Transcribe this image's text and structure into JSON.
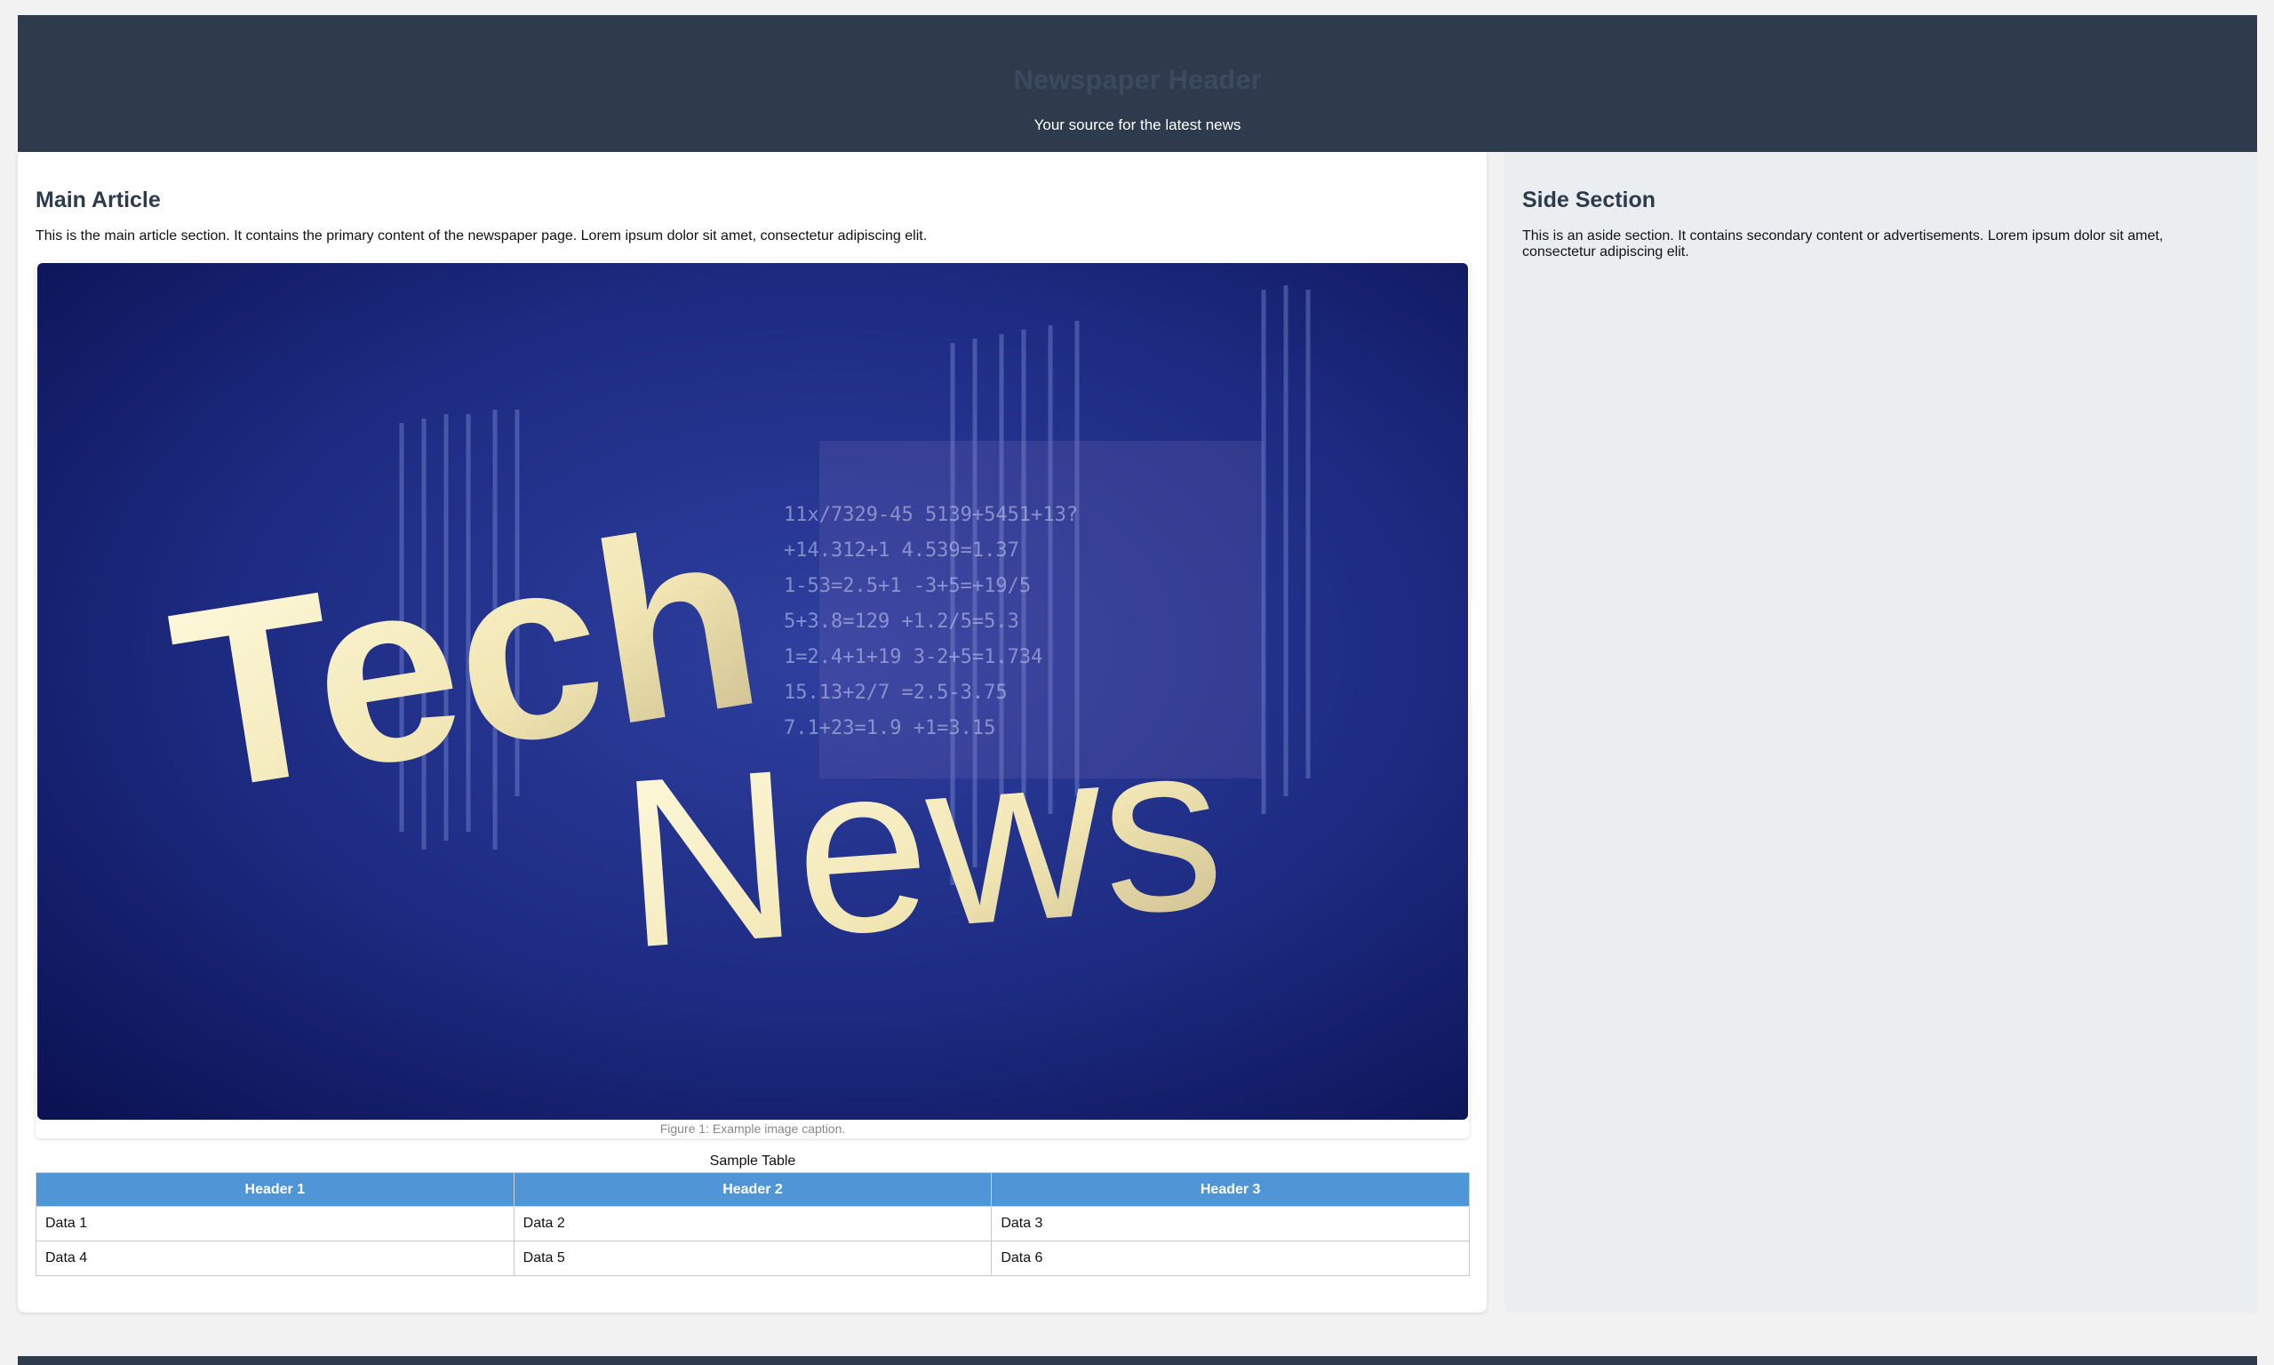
{
  "header": {
    "title": "Newspaper Header",
    "subtitle": "Your source for the latest news"
  },
  "main": {
    "heading": "Main Article",
    "intro": "This is the main article section. It contains the primary content of the newspaper page. Lorem ipsum dolor sit amet, consectetur adipiscing elit.",
    "figure": {
      "image_text_line1": "Tech",
      "image_text_line2": "News",
      "caption": "Figure 1: Example image caption."
    },
    "table": {
      "caption": "Sample Table",
      "headers": [
        "Header 1",
        "Header 2",
        "Header 3"
      ],
      "rows": [
        [
          "Data 1",
          "Data 2",
          "Data 3"
        ],
        [
          "Data 4",
          "Data 5",
          "Data 6"
        ]
      ]
    }
  },
  "aside": {
    "heading": "Side Section",
    "text": "This is an aside section. It contains secondary content or advertisements. Lorem ipsum dolor sit amet, consectetur adipiscing elit."
  },
  "colors": {
    "header_bg": "#2e3b4d",
    "table_header_bg": "#5096d6",
    "aside_bg": "#ebeef0",
    "image_bg": "#1c2a78"
  }
}
